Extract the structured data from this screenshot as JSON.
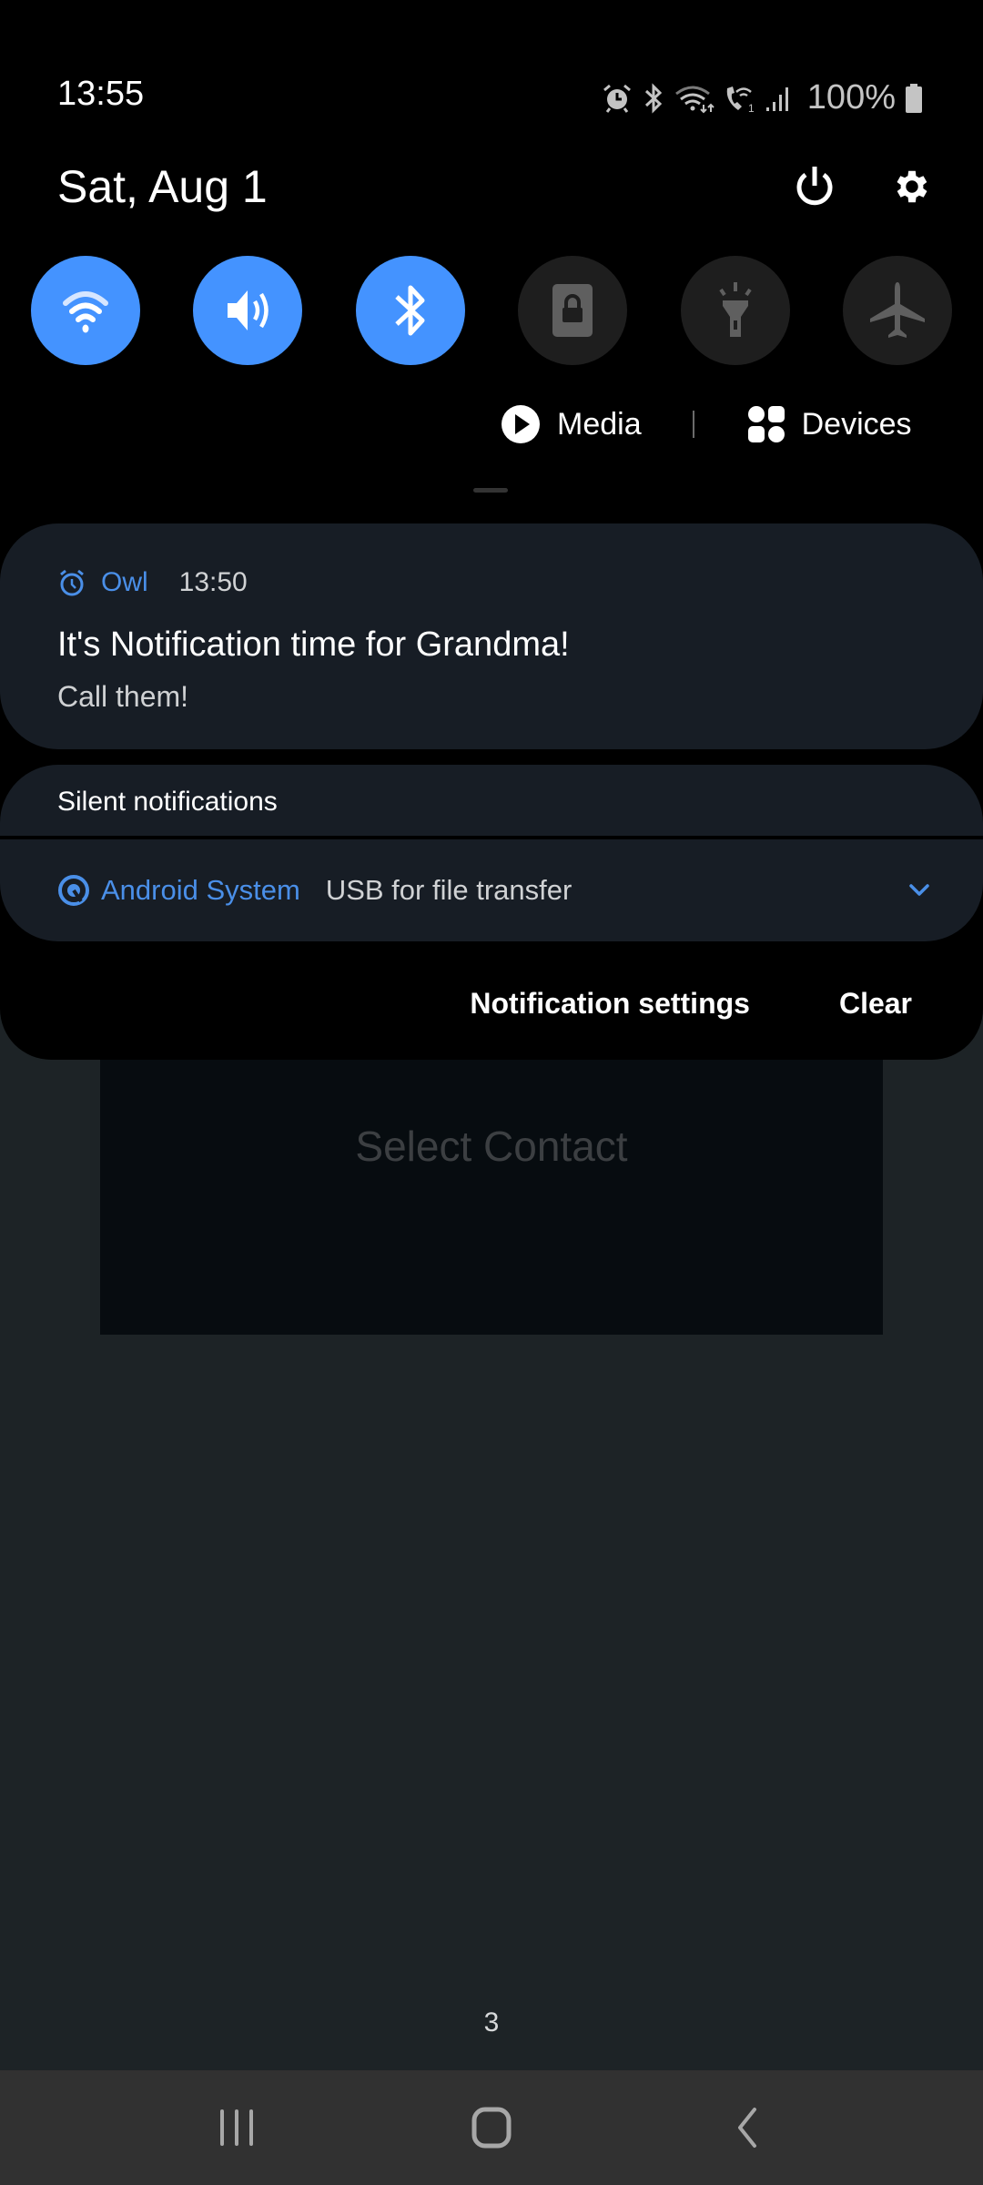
{
  "status_bar": {
    "time": "13:55",
    "icons": [
      "alarm-icon",
      "bluetooth-icon",
      "wifi-icon",
      "wifi-calling-icon",
      "signal-icon",
      "battery-icon"
    ],
    "battery": "100%"
  },
  "header": {
    "date": "Sat, Aug 1",
    "power_icon": "power-icon",
    "settings_icon": "gear-icon"
  },
  "quick_settings": [
    {
      "name": "Wi-Fi",
      "icon": "wifi-icon",
      "state": "on"
    },
    {
      "name": "Sound",
      "icon": "volume-icon",
      "state": "on"
    },
    {
      "name": "Bluetooth",
      "icon": "bluetooth-icon",
      "state": "on"
    },
    {
      "name": "Auto rotate lock",
      "icon": "rotation-lock-icon",
      "state": "off"
    },
    {
      "name": "Flashlight",
      "icon": "flashlight-icon",
      "state": "off"
    },
    {
      "name": "Airplane mode",
      "icon": "airplane-icon",
      "state": "off"
    }
  ],
  "media_row": {
    "media_label": "Media",
    "devices_label": "Devices"
  },
  "notification": {
    "app": "Owl",
    "time": "13:50",
    "title": "It's Notification time for Grandma!",
    "body": "Call them!"
  },
  "silent": {
    "header": "Silent notifications",
    "app": "Android System",
    "text": "USB for file transfer"
  },
  "footer": {
    "settings_label": "Notification settings",
    "clear_label": "Clear"
  },
  "app": {
    "select_contact": "Select Contact",
    "page_number": "3"
  },
  "colors": {
    "accent": "#4493ff",
    "app_name": "#4a8fe8",
    "card_bg": "#171d25",
    "app_bg": "#1d2326"
  }
}
